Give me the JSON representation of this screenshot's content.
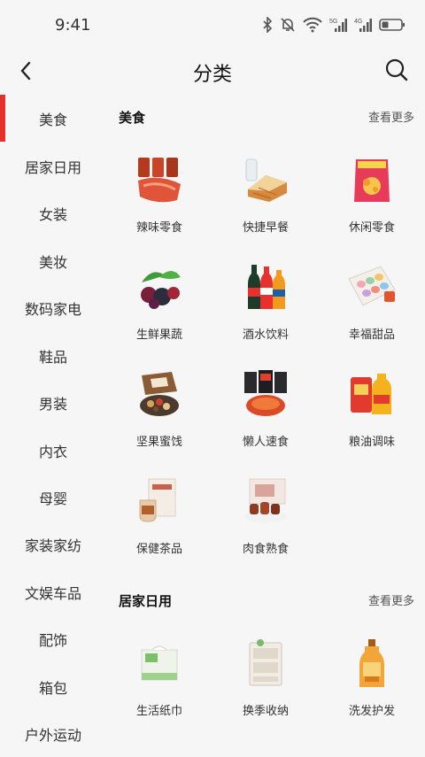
{
  "status": {
    "time": "9:41"
  },
  "nav": {
    "title": "分类"
  },
  "sidebar": {
    "items": [
      "美食",
      "居家日用",
      "女装",
      "美妆",
      "数码家电",
      "鞋品",
      "男装",
      "内衣",
      "母婴",
      "家装家纺",
      "文娱车品",
      "配饰",
      "箱包",
      "户外运动"
    ],
    "active_index": 0,
    "accent_color": "#e6302b"
  },
  "sections": [
    {
      "title": "美食",
      "more_label": "查看更多",
      "items": [
        {
          "label": "辣味零食",
          "icon": "spicy-snack-icon"
        },
        {
          "label": "快捷早餐",
          "icon": "breakfast-bread-icon"
        },
        {
          "label": "休闲零食",
          "icon": "chips-bag-icon"
        },
        {
          "label": "生鲜果蔬",
          "icon": "fresh-fruit-icon"
        },
        {
          "label": "酒水饮料",
          "icon": "drink-bottles-icon"
        },
        {
          "label": "幸福甜品",
          "icon": "macaron-box-icon"
        },
        {
          "label": "坚果蜜饯",
          "icon": "nut-box-icon"
        },
        {
          "label": "懒人速食",
          "icon": "instant-food-icon"
        },
        {
          "label": "粮油调味",
          "icon": "rice-oil-icon"
        },
        {
          "label": "保健茶品",
          "icon": "tea-box-icon"
        },
        {
          "label": "肉食熟食",
          "icon": "cooked-meat-icon"
        }
      ]
    },
    {
      "title": "居家日用",
      "more_label": "查看更多",
      "items": [
        {
          "label": "生活纸巾",
          "icon": "tissue-box-icon"
        },
        {
          "label": "换季收纳",
          "icon": "storage-box-icon"
        },
        {
          "label": "洗发护发",
          "icon": "shampoo-bottle-icon"
        }
      ]
    }
  ]
}
